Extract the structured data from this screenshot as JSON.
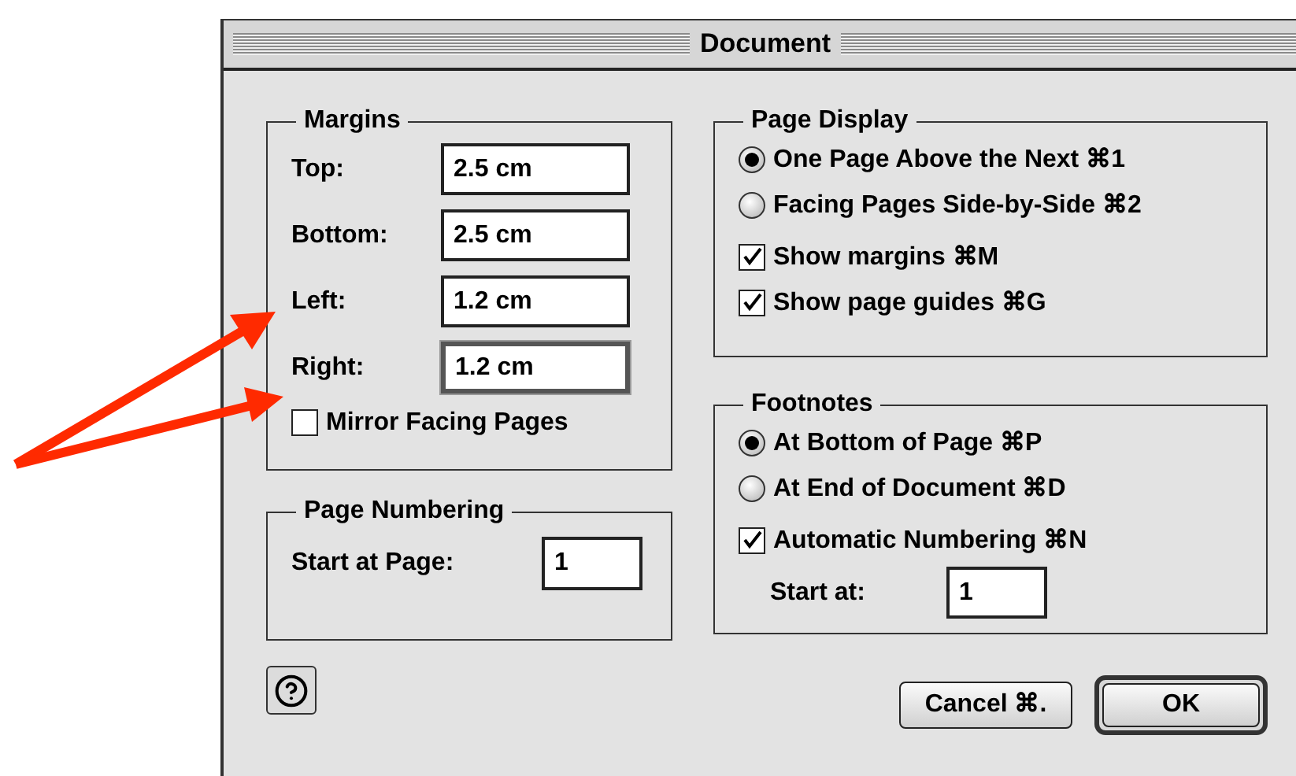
{
  "window": {
    "title": "Document"
  },
  "margins": {
    "title": "Margins",
    "fields": [
      {
        "label": "Top:",
        "value": "2.5 cm",
        "focused": false
      },
      {
        "label": "Bottom:",
        "value": "2.5 cm",
        "focused": false
      },
      {
        "label": "Left:",
        "value": "1.2 cm",
        "focused": false
      },
      {
        "label": "Right:",
        "value": "1.2 cm",
        "focused": true
      }
    ],
    "mirror": {
      "label": "Mirror Facing Pages",
      "checked": false
    }
  },
  "page_numbering": {
    "title": "Page Numbering",
    "label": "Start at Page:",
    "value": "1"
  },
  "page_display": {
    "title": "Page Display",
    "options": [
      {
        "label": "One Page Above the Next ⌘1",
        "selected": true
      },
      {
        "label": "Facing Pages Side-by-Side ⌘2",
        "selected": false
      }
    ],
    "checkboxes": [
      {
        "label": "Show margins ⌘M",
        "checked": true
      },
      {
        "label": "Show page guides ⌘G",
        "checked": true
      }
    ]
  },
  "footnotes": {
    "title": "Footnotes",
    "options": [
      {
        "label": "At Bottom of Page ⌘P",
        "selected": true
      },
      {
        "label": "At End of Document ⌘D",
        "selected": false
      }
    ],
    "checkbox": {
      "label": "Automatic Numbering ⌘N",
      "checked": true
    },
    "start": {
      "label": "Start at:",
      "value": "1"
    }
  },
  "buttons": [
    {
      "label": "Cancel ⌘.",
      "default": false
    },
    {
      "label": "OK",
      "default": true
    }
  ]
}
